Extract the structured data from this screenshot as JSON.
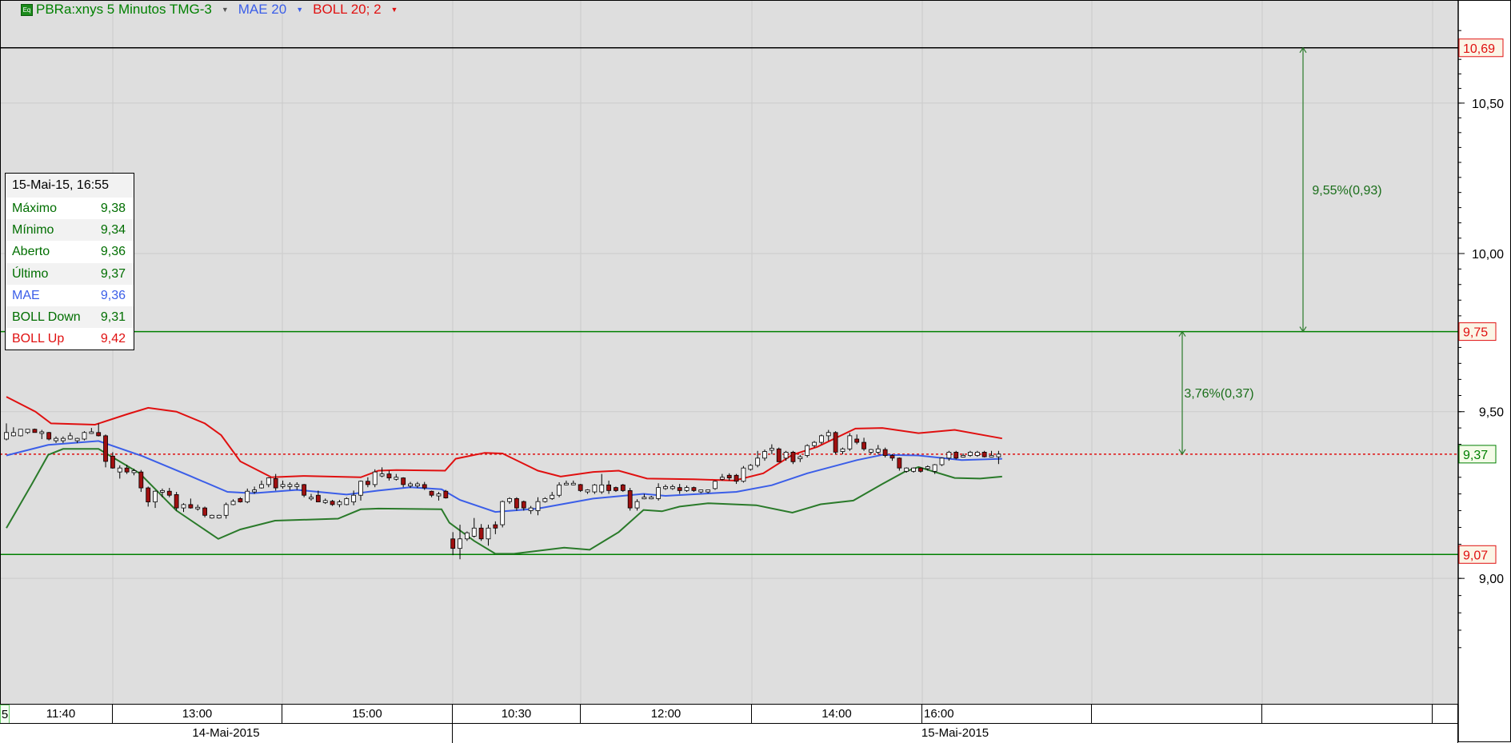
{
  "header": {
    "icon": "equity-icon",
    "icon_text": "Eq",
    "symbol": "PBRa:xnys 5 Minutos TMG-3",
    "indicator1": "MAE 20",
    "indicator2": "BOLL 20; 2",
    "colors": {
      "symbol": "#008000",
      "mae": "#3b5ee8",
      "boll": "#e01010"
    }
  },
  "info_box": {
    "datetime": "15-Mai-15, 16:55",
    "rows": [
      {
        "label": "Máximo",
        "value": "9,38",
        "color": "#006e00"
      },
      {
        "label": "Mínimo",
        "value": "9,34",
        "color": "#006e00"
      },
      {
        "label": "Aberto",
        "value": "9,36",
        "color": "#006e00"
      },
      {
        "label": "Último",
        "value": "9,37",
        "color": "#006e00"
      },
      {
        "label": "MAE",
        "value": "9,36",
        "color": "#3b5ee8"
      },
      {
        "label": "BOLL Down",
        "value": "9,31",
        "color": "#006e00"
      },
      {
        "label": "BOLL Up",
        "value": "9,42",
        "color": "#e01010"
      }
    ]
  },
  "time_axis": {
    "labels": [
      "5",
      "11:40",
      "13:00",
      "15:00",
      "10:30",
      "12:00",
      "14:00",
      "16:00",
      "",
      "",
      ""
    ],
    "dates": [
      "14-Mai-2015",
      "15-Mai-2015"
    ]
  },
  "chart_data": {
    "type": "candlestick",
    "title": "PBRa:xnys 5 Minutos TMG-3",
    "scale": "log",
    "ylim": [
      8.75,
      10.78
    ],
    "y_ticks": [
      {
        "value": 10.5,
        "label": "10,50"
      },
      {
        "value": 10.0,
        "label": "10,00"
      },
      {
        "value": 9.5,
        "label": "9,50"
      },
      {
        "value": 9.0,
        "label": "9,00"
      }
    ],
    "grid": true,
    "price_markers": [
      {
        "value": 10.69,
        "label": "10,69",
        "line_color": "#000000",
        "label_color": "#e01010",
        "style": "solid"
      },
      {
        "value": 9.75,
        "label": "9,75",
        "line_color": "#008000",
        "label_color": "#e01010",
        "style": "solid"
      },
      {
        "value": 9.37,
        "label": "9,37",
        "line_color": "#e01010",
        "label_color": "#008000",
        "style": "dotted"
      },
      {
        "value": 9.07,
        "label": "9,07",
        "line_color": "#008000",
        "label_color": "#e01010",
        "style": "solid"
      }
    ],
    "measurements": [
      {
        "from": 9.75,
        "to": 10.69,
        "label": "9,55%(0,93)"
      },
      {
        "from": 9.75,
        "to": 9.37,
        "label": "3,76%(0,37)"
      }
    ],
    "candle_columns": [
      "open",
      "high",
      "low",
      "close"
    ],
    "candles": [
      [
        9.416,
        9.464,
        9.412,
        9.436
      ],
      [
        9.426,
        9.452,
        9.424,
        9.436
      ],
      [
        9.426,
        9.446,
        9.424,
        9.446
      ],
      [
        9.436,
        9.446,
        9.432,
        9.446
      ],
      [
        9.446,
        9.448,
        9.436,
        9.436
      ],
      [
        9.434,
        9.444,
        9.416,
        9.438
      ],
      [
        9.436,
        9.438,
        9.412,
        9.416
      ],
      [
        9.411,
        9.424,
        9.404,
        9.418
      ],
      [
        9.411,
        9.424,
        9.404,
        9.418
      ],
      [
        9.416,
        9.436,
        9.414,
        9.426
      ],
      [
        9.411,
        9.42,
        9.404,
        9.418
      ],
      [
        9.416,
        9.44,
        9.412,
        9.436
      ],
      [
        9.434,
        9.45,
        9.432,
        9.438
      ],
      [
        9.436,
        9.464,
        9.424,
        9.426
      ],
      [
        9.426,
        9.43,
        9.33,
        9.348
      ],
      [
        9.364,
        9.376,
        9.326,
        9.328
      ],
      [
        9.316,
        9.336,
        9.296,
        9.328
      ],
      [
        9.328,
        9.338,
        9.31,
        9.316
      ],
      [
        9.314,
        9.326,
        9.306,
        9.32
      ],
      [
        9.316,
        9.322,
        9.256,
        9.268
      ],
      [
        9.268,
        9.272,
        9.212,
        9.226
      ],
      [
        9.226,
        9.26,
        9.208,
        9.258
      ],
      [
        9.256,
        9.266,
        9.24,
        9.26
      ],
      [
        9.258,
        9.268,
        9.24,
        9.246
      ],
      [
        9.248,
        9.256,
        9.2,
        9.208
      ],
      [
        9.208,
        9.222,
        9.196,
        9.218
      ],
      [
        9.218,
        9.236,
        9.206,
        9.208
      ],
      [
        9.206,
        9.218,
        9.2,
        9.21
      ],
      [
        9.208,
        9.212,
        9.18,
        9.186
      ],
      [
        9.178,
        9.188,
        9.176,
        9.186
      ],
      [
        9.178,
        9.188,
        9.176,
        9.186
      ],
      [
        9.186,
        9.224,
        9.176,
        9.218
      ],
      [
        9.218,
        9.234,
        9.216,
        9.228
      ],
      [
        9.236,
        9.24,
        9.224,
        9.226
      ],
      [
        9.226,
        9.266,
        9.222,
        9.258
      ],
      [
        9.256,
        9.272,
        9.25,
        9.262
      ],
      [
        9.268,
        9.29,
        9.266,
        9.278
      ],
      [
        9.278,
        9.3,
        9.27,
        9.298
      ],
      [
        9.296,
        9.31,
        9.26,
        9.268
      ],
      [
        9.272,
        9.29,
        9.266,
        9.278
      ],
      [
        9.272,
        9.285,
        9.262,
        9.278
      ],
      [
        9.272,
        9.285,
        9.262,
        9.278
      ],
      [
        9.278,
        9.28,
        9.24,
        9.246
      ],
      [
        9.24,
        9.25,
        9.23,
        9.24
      ],
      [
        9.246,
        9.26,
        9.226,
        9.226
      ],
      [
        9.224,
        9.236,
        9.22,
        9.23
      ],
      [
        9.228,
        9.232,
        9.214,
        9.218
      ],
      [
        9.218,
        9.232,
        9.21,
        9.226
      ],
      [
        9.218,
        9.24,
        9.216,
        9.236
      ],
      [
        9.226,
        9.26,
        9.216,
        9.246
      ],
      [
        9.246,
        9.29,
        9.23,
        9.288
      ],
      [
        9.288,
        9.3,
        9.27,
        9.278
      ],
      [
        9.278,
        9.324,
        9.27,
        9.316
      ],
      [
        9.304,
        9.33,
        9.3,
        9.31
      ],
      [
        9.31,
        9.32,
        9.29,
        9.298
      ],
      [
        9.294,
        9.31,
        9.29,
        9.3
      ],
      [
        9.298,
        9.3,
        9.27,
        9.278
      ],
      [
        9.274,
        9.286,
        9.268,
        9.28
      ],
      [
        9.274,
        9.286,
        9.268,
        9.28
      ],
      [
        9.278,
        9.286,
        9.262,
        9.268
      ],
      [
        9.258,
        9.26,
        9.24,
        9.246
      ],
      [
        9.244,
        9.256,
        9.23,
        9.25
      ],
      [
        9.258,
        9.262,
        9.236,
        9.238
      ],
      [
        9.116,
        9.136,
        9.068,
        9.088
      ],
      [
        9.088,
        9.158,
        9.056,
        9.116
      ],
      [
        9.116,
        9.138,
        9.11,
        9.134
      ],
      [
        9.124,
        9.178,
        9.12,
        9.148
      ],
      [
        9.148,
        9.16,
        9.11,
        9.116
      ],
      [
        9.116,
        9.158,
        9.096,
        9.148
      ],
      [
        9.158,
        9.168,
        9.13,
        9.148
      ],
      [
        9.158,
        9.23,
        9.15,
        9.227
      ],
      [
        9.227,
        9.24,
        9.22,
        9.236
      ],
      [
        9.236,
        9.24,
        9.2,
        9.208
      ],
      [
        9.227,
        9.23,
        9.2,
        9.208
      ],
      [
        9.2,
        9.214,
        9.19,
        9.208
      ],
      [
        9.2,
        9.24,
        9.186,
        9.227
      ],
      [
        9.227,
        9.24,
        9.224,
        9.236
      ],
      [
        9.236,
        9.256,
        9.232,
        9.246
      ],
      [
        9.246,
        9.285,
        9.24,
        9.277
      ],
      [
        9.278,
        9.29,
        9.276,
        9.282
      ],
      [
        9.278,
        9.29,
        9.276,
        9.282
      ],
      [
        9.278,
        9.28,
        9.256,
        9.26
      ],
      [
        9.256,
        9.264,
        9.25,
        9.262
      ],
      [
        9.256,
        9.28,
        9.25,
        9.277
      ],
      [
        9.256,
        9.31,
        9.25,
        9.277
      ],
      [
        9.277,
        9.29,
        9.25,
        9.26
      ],
      [
        9.269,
        9.272,
        9.256,
        9.26
      ],
      [
        9.277,
        9.28,
        9.256,
        9.26
      ],
      [
        9.26,
        9.268,
        9.2,
        9.208
      ],
      [
        9.208,
        9.234,
        9.2,
        9.227
      ],
      [
        9.236,
        9.25,
        9.234,
        9.24
      ],
      [
        9.236,
        9.244,
        9.234,
        9.24
      ],
      [
        9.236,
        9.282,
        9.23,
        9.269
      ],
      [
        9.266,
        9.278,
        9.262,
        9.272
      ],
      [
        9.266,
        9.278,
        9.262,
        9.272
      ],
      [
        9.269,
        9.28,
        9.25,
        9.26
      ],
      [
        9.26,
        9.275,
        9.256,
        9.269
      ],
      [
        9.269,
        9.272,
        9.256,
        9.26
      ],
      [
        9.256,
        9.262,
        9.252,
        9.262
      ],
      [
        9.256,
        9.262,
        9.252,
        9.262
      ],
      [
        9.266,
        9.29,
        9.262,
        9.288
      ],
      [
        9.294,
        9.31,
        9.29,
        9.3
      ],
      [
        9.306,
        9.312,
        9.29,
        9.298
      ],
      [
        9.306,
        9.31,
        9.28,
        9.288
      ],
      [
        9.288,
        9.334,
        9.284,
        9.328
      ],
      [
        9.324,
        9.34,
        9.32,
        9.336
      ],
      [
        9.336,
        9.38,
        9.33,
        9.358
      ],
      [
        9.358,
        9.384,
        9.35,
        9.378
      ],
      [
        9.382,
        9.4,
        9.37,
        9.388
      ],
      [
        9.386,
        9.39,
        9.346,
        9.347
      ],
      [
        9.358,
        9.38,
        9.35,
        9.376
      ],
      [
        9.376,
        9.38,
        9.34,
        9.347
      ],
      [
        9.356,
        9.368,
        9.346,
        9.362
      ],
      [
        9.366,
        9.4,
        9.36,
        9.396
      ],
      [
        9.396,
        9.41,
        9.39,
        9.406
      ],
      [
        9.406,
        9.43,
        9.4,
        9.426
      ],
      [
        9.426,
        9.444,
        9.41,
        9.436
      ],
      [
        9.436,
        9.44,
        9.37,
        9.376
      ],
      [
        9.378,
        9.39,
        9.37,
        9.386
      ],
      [
        9.386,
        9.434,
        9.38,
        9.426
      ],
      [
        9.416,
        9.43,
        9.4,
        9.406
      ],
      [
        9.406,
        9.42,
        9.38,
        9.386
      ],
      [
        9.376,
        9.386,
        9.37,
        9.384
      ],
      [
        9.376,
        9.398,
        9.37,
        9.386
      ],
      [
        9.384,
        9.39,
        9.36,
        9.366
      ],
      [
        9.366,
        9.37,
        9.35,
        9.358
      ],
      [
        9.358,
        9.36,
        9.32,
        9.328
      ],
      [
        9.318,
        9.33,
        9.314,
        9.328
      ],
      [
        9.318,
        9.33,
        9.314,
        9.328
      ],
      [
        9.328,
        9.33,
        9.314,
        9.318
      ],
      [
        9.326,
        9.336,
        9.32,
        9.332
      ],
      [
        9.318,
        9.34,
        9.31,
        9.338
      ],
      [
        9.338,
        9.36,
        9.334,
        9.358
      ],
      [
        9.358,
        9.38,
        9.35,
        9.376
      ],
      [
        9.376,
        9.38,
        9.354,
        9.358
      ],
      [
        9.362,
        9.372,
        9.36,
        9.366
      ],
      [
        9.366,
        9.38,
        9.362,
        9.376
      ],
      [
        9.366,
        9.38,
        9.362,
        9.376
      ],
      [
        9.376,
        9.38,
        9.36,
        9.362
      ],
      [
        9.362,
        9.38,
        9.36,
        9.366
      ],
      [
        9.362,
        9.38,
        9.34,
        9.37
      ]
    ],
    "series": [
      {
        "name": "BOLL Up",
        "color": "#e01010",
        "points": [
          [
            0,
            9.546
          ],
          [
            4.1,
            9.5
          ],
          [
            6.3,
            9.464
          ],
          [
            12.5,
            9.46
          ],
          [
            17,
            9.492
          ],
          [
            20,
            9.512
          ],
          [
            24,
            9.5
          ],
          [
            28,
            9.464
          ],
          [
            30.3,
            9.428
          ],
          [
            33,
            9.348
          ],
          [
            37.4,
            9.3
          ],
          [
            41.9,
            9.304
          ],
          [
            50,
            9.3
          ],
          [
            52.5,
            9.32
          ],
          [
            55,
            9.322
          ],
          [
            61.9,
            9.32
          ],
          [
            63.4,
            9.356
          ],
          [
            67.5,
            9.374
          ],
          [
            70,
            9.372
          ],
          [
            75,
            9.32
          ],
          [
            78.2,
            9.302
          ],
          [
            82.8,
            9.316
          ],
          [
            86.4,
            9.32
          ],
          [
            90.4,
            9.296
          ],
          [
            97,
            9.294
          ],
          [
            102.7,
            9.29
          ],
          [
            106.8,
            9.312
          ],
          [
            110.9,
            9.368
          ],
          [
            114.4,
            9.392
          ],
          [
            119.8,
            9.448
          ],
          [
            123.6,
            9.45
          ],
          [
            128.7,
            9.434
          ],
          [
            133.8,
            9.444
          ],
          [
            138.9,
            9.424
          ],
          [
            140.5,
            9.418
          ]
        ]
      },
      {
        "name": "MAE",
        "color": "#3b5ee8",
        "points": [
          [
            0,
            9.366
          ],
          [
            5.9,
            9.398
          ],
          [
            13,
            9.41
          ],
          [
            19.2,
            9.364
          ],
          [
            25.9,
            9.304
          ],
          [
            31.2,
            9.256
          ],
          [
            34.8,
            9.252
          ],
          [
            41,
            9.262
          ],
          [
            48,
            9.248
          ],
          [
            52.5,
            9.26
          ],
          [
            57,
            9.27
          ],
          [
            61.4,
            9.264
          ],
          [
            64,
            9.232
          ],
          [
            69,
            9.196
          ],
          [
            75,
            9.206
          ],
          [
            82.8,
            9.236
          ],
          [
            89.9,
            9.25
          ],
          [
            93,
            9.244
          ],
          [
            103,
            9.256
          ],
          [
            108,
            9.276
          ],
          [
            113,
            9.312
          ],
          [
            120,
            9.352
          ],
          [
            123.6,
            9.368
          ],
          [
            128.7,
            9.366
          ],
          [
            134.8,
            9.352
          ],
          [
            140.5,
            9.356
          ]
        ]
      },
      {
        "name": "BOLL Down",
        "color": "#2a7a2a",
        "points": [
          [
            0,
            9.148
          ],
          [
            3.6,
            9.28
          ],
          [
            5.9,
            9.368
          ],
          [
            8,
            9.386
          ],
          [
            13,
            9.386
          ],
          [
            18.8,
            9.312
          ],
          [
            24,
            9.2
          ],
          [
            29.9,
            9.116
          ],
          [
            33,
            9.144
          ],
          [
            37.9,
            9.17
          ],
          [
            46.8,
            9.176
          ],
          [
            50,
            9.204
          ],
          [
            52.5,
            9.206
          ],
          [
            61.4,
            9.204
          ],
          [
            62.5,
            9.164
          ],
          [
            66,
            9.11
          ],
          [
            69,
            9.072
          ],
          [
            71.6,
            9.072
          ],
          [
            78.7,
            9.09
          ],
          [
            82.3,
            9.084
          ],
          [
            86.4,
            9.136
          ],
          [
            89.9,
            9.202
          ],
          [
            92.5,
            9.198
          ],
          [
            95,
            9.212
          ],
          [
            99,
            9.222
          ],
          [
            105.8,
            9.216
          ],
          [
            110.9,
            9.194
          ],
          [
            114.9,
            9.219
          ],
          [
            119.5,
            9.23
          ],
          [
            123.6,
            9.28
          ],
          [
            126.7,
            9.316
          ],
          [
            128.7,
            9.331
          ],
          [
            133.8,
            9.298
          ],
          [
            137.4,
            9.296
          ],
          [
            140.5,
            9.302
          ]
        ]
      }
    ]
  }
}
